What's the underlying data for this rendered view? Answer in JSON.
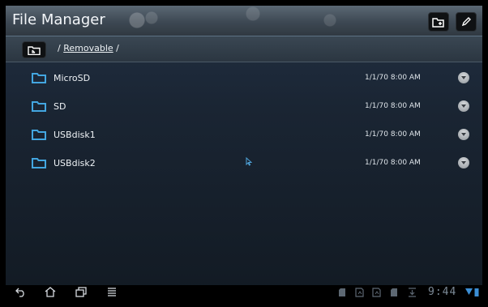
{
  "app": {
    "title": "File Manager"
  },
  "path": {
    "prefix": "/",
    "current": "Removable",
    "suffix": "/"
  },
  "files": [
    {
      "name": "MicroSD",
      "date": "1/1/70 8:00 AM"
    },
    {
      "name": "SD",
      "date": "1/1/70 8:00 AM"
    },
    {
      "name": "USBdisk1",
      "date": "1/1/70 8:00 AM"
    },
    {
      "name": "USBdisk2",
      "date": "1/1/70 8:00 AM"
    }
  ],
  "status": {
    "time": "9:44"
  },
  "icons": {
    "toolbar": [
      "new-folder-icon",
      "edit-icon"
    ],
    "path": [
      "up-folder-icon"
    ],
    "file": "folder-icon",
    "menu": "item-menu-icon",
    "nav": [
      "back-icon",
      "home-icon",
      "recent-apps-icon",
      "menu-icon"
    ],
    "status": [
      "sd-card-icon",
      "usb-icon",
      "usb-icon",
      "sd-card-icon",
      "download-icon",
      "wifi-icon",
      "battery-icon"
    ]
  },
  "colors": {
    "accent": "#4fa3d8",
    "folder": "#43a6e0"
  }
}
